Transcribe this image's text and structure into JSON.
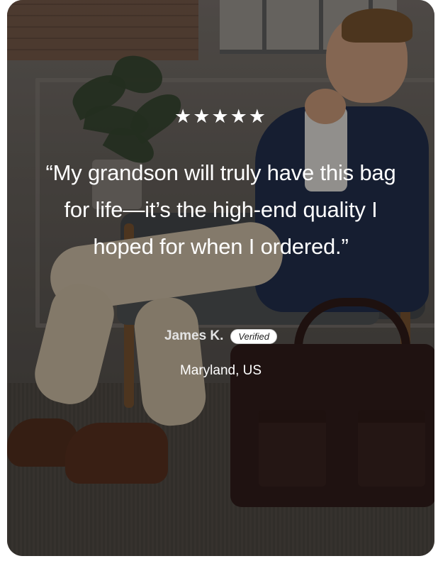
{
  "review": {
    "rating": 5,
    "stars_text": "★★★★★",
    "quote": "“My grandson will truly have this bag for life—it’s the high-end quality I hoped for when I ordered.”",
    "author": "James K.",
    "badge": "Verified",
    "location": "Maryland, US"
  },
  "icons": {
    "star": "star-icon"
  },
  "colors": {
    "text": "#ffffff",
    "badge_bg": "#ffffff",
    "badge_text": "#222222"
  }
}
